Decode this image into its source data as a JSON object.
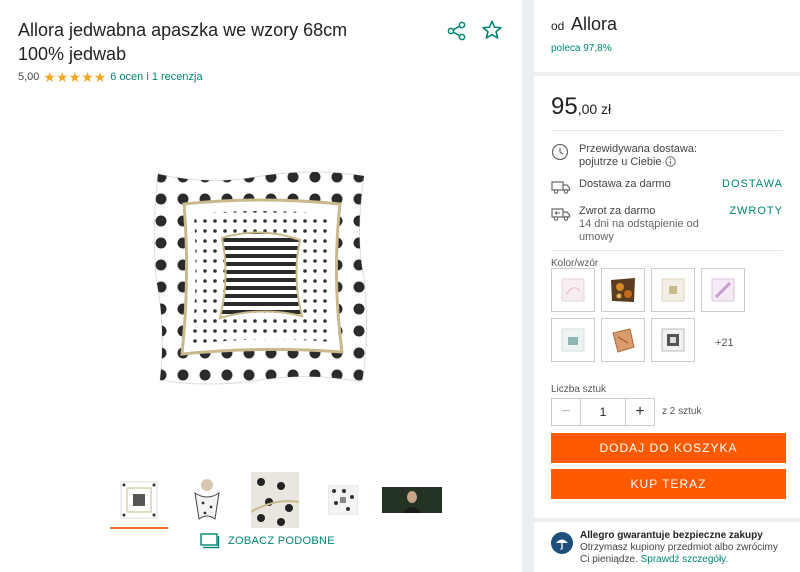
{
  "product": {
    "title": "Allora jedwabna apaszka we wzory 68cm 100% jedwab",
    "rating_value": "5,00",
    "rating_link": "6 ocen i 1 recenzja",
    "stars": 5
  },
  "gallery": {
    "see_similar": "ZOBACZ PODOBNE"
  },
  "seller": {
    "prefix": "od",
    "name": "Allora",
    "recommend": "poleca 97,8%"
  },
  "offer": {
    "price_main": "95",
    "price_rest": ",00 zł",
    "delivery_title": "Przewidywana dostawa:",
    "delivery_value": "pojutrze u Ciebie",
    "free_shipping": "Dostawa za darmo",
    "free_shipping_link": "DOSTAWA",
    "free_return": "Zwrot za darmo",
    "free_return_sub": "14 dni na odstąpienie od umowy",
    "free_return_link": "ZWROTY",
    "color_label": "Kolor/wzór",
    "more_colors": "+21",
    "qty_label": "Liczba sztuk",
    "qty_value": "1",
    "qty_of": "z 2 sztuk",
    "add_to_cart": "DODAJ DO KOSZYKA",
    "buy_now": "KUP TERAZ"
  },
  "guarantee": {
    "title": "Allegro gwarantuje bezpieczne zakupy",
    "text": "Otrzymasz kupiony przedmiot albo zwrócimy Ci pieniądze.",
    "link": "Sprawdź szczegóły."
  },
  "colors": {
    "accent": "#008673",
    "orange": "#ff5a00",
    "star": "#f5a623"
  }
}
